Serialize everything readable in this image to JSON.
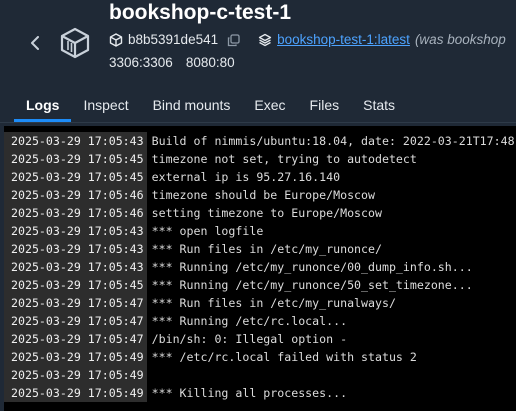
{
  "header": {
    "title": "bookshop-c-test-1",
    "container_id": "b8b5391de541",
    "image_link": "bookshop-test-1:latest",
    "image_note": "(was bookshop",
    "ports": [
      "3306:3306",
      "8080:80"
    ]
  },
  "tabs": [
    {
      "label": "Logs",
      "active": true
    },
    {
      "label": "Inspect",
      "active": false
    },
    {
      "label": "Bind mounts",
      "active": false
    },
    {
      "label": "Exec",
      "active": false
    },
    {
      "label": "Files",
      "active": false
    },
    {
      "label": "Stats",
      "active": false
    }
  ],
  "logs": [
    {
      "ts": "2025-03-29 17:05:43",
      "msg": "Build of nimmis/ubuntu:18.04, date: 2022-03-21T17:48"
    },
    {
      "ts": "2025-03-29 17:05:45",
      "msg": "timezone not set, trying to autodetect"
    },
    {
      "ts": "2025-03-29 17:05:45",
      "msg": "external ip is 95.27.16.140"
    },
    {
      "ts": "2025-03-29 17:05:46",
      "msg": "timezone should be Europe/Moscow"
    },
    {
      "ts": "2025-03-29 17:05:46",
      "msg": "setting timezone to Europe/Moscow"
    },
    {
      "ts": "2025-03-29 17:05:43",
      "msg": "*** open logfile"
    },
    {
      "ts": "2025-03-29 17:05:43",
      "msg": "*** Run files in /etc/my_runonce/"
    },
    {
      "ts": "2025-03-29 17:05:43",
      "msg": "*** Running /etc/my_runonce/00_dump_info.sh..."
    },
    {
      "ts": "2025-03-29 17:05:45",
      "msg": "*** Running /etc/my_runonce/50_set_timezone..."
    },
    {
      "ts": "2025-03-29 17:05:47",
      "msg": "*** Run files in /etc/my_runalways/"
    },
    {
      "ts": "2025-03-29 17:05:47",
      "msg": "*** Running /etc/rc.local..."
    },
    {
      "ts": "2025-03-29 17:05:47",
      "msg": "/bin/sh: 0: Illegal option -"
    },
    {
      "ts": "2025-03-29 17:05:49",
      "msg": "*** /etc/rc.local failed with status 2"
    },
    {
      "ts": "2025-03-29 17:05:49",
      "msg": ""
    },
    {
      "ts": "2025-03-29 17:05:49",
      "msg": "*** Killing all processes..."
    }
  ],
  "colors": {
    "background": "#1f2936",
    "accent": "#1d8cf8",
    "link": "#4da3ff",
    "log_background": "#000000"
  },
  "icons": [
    "chevron-left-icon",
    "container-cube-icon",
    "hash-cube-icon",
    "copy-icon",
    "image-stack-icon"
  ]
}
